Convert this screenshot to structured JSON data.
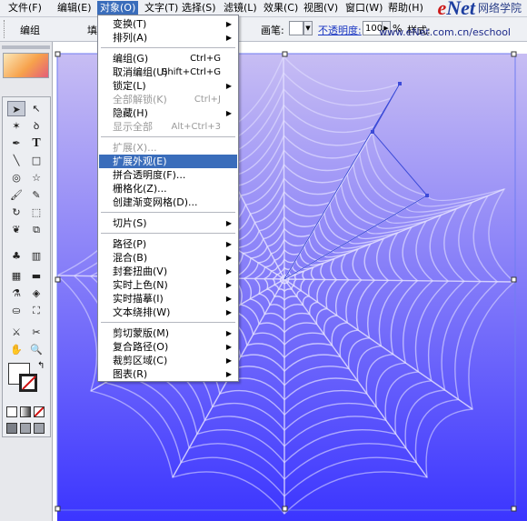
{
  "menubar": {
    "items": [
      {
        "label": "文件(F)"
      },
      {
        "label": "编辑(E)"
      },
      {
        "label": "对象(O)"
      },
      {
        "label": "文字(T)"
      },
      {
        "label": "选择(S)"
      },
      {
        "label": "滤镜(L)"
      },
      {
        "label": "效果(C)"
      },
      {
        "label": "视图(V)"
      },
      {
        "label": "窗口(W)"
      },
      {
        "label": "帮助(H)"
      }
    ]
  },
  "brand": {
    "logo": "eNet",
    "logo_e": "e",
    "logo_rest": "Net",
    "logo_suffix": ".com.cn",
    "chinese": "网络学院",
    "url": "www.eNet.com.cn/eschool"
  },
  "control_bar": {
    "group_label": "编组",
    "fill_label": "填",
    "brush_label": "画笔:",
    "opacity_label": "不透明度:",
    "opacity_value": "100",
    "percent": "%",
    "style_label": "样式:"
  },
  "object_menu": {
    "items": [
      {
        "label": "变换(T)",
        "shortcut": "",
        "submenu": true,
        "disabled": false
      },
      {
        "label": "排列(A)",
        "shortcut": "",
        "submenu": true,
        "disabled": false
      },
      {
        "label": "编组(G)",
        "shortcut": "Ctrl+G",
        "submenu": false,
        "disabled": false
      },
      {
        "label": "取消编组(U)",
        "shortcut": "Shift+Ctrl+G",
        "submenu": false,
        "disabled": false
      },
      {
        "label": "锁定(L)",
        "shortcut": "",
        "submenu": true,
        "disabled": false
      },
      {
        "label": "全部解锁(K)",
        "shortcut": "Ctrl+J",
        "submenu": false,
        "disabled": true
      },
      {
        "label": "隐藏(H)",
        "shortcut": "",
        "submenu": true,
        "disabled": false
      },
      {
        "label": "显示全部",
        "shortcut": "Alt+Ctrl+3",
        "submenu": false,
        "disabled": true
      },
      {
        "label": "扩展(X)...",
        "shortcut": "",
        "submenu": false,
        "disabled": true
      },
      {
        "label": "扩展外观(E)",
        "shortcut": "",
        "submenu": false,
        "disabled": false,
        "highlighted": true
      },
      {
        "label": "拼合透明度(F)...",
        "shortcut": "",
        "submenu": false,
        "disabled": false
      },
      {
        "label": "栅格化(Z)...",
        "shortcut": "",
        "submenu": false,
        "disabled": false
      },
      {
        "label": "创建渐变网格(D)...",
        "shortcut": "",
        "submenu": false,
        "disabled": false
      },
      {
        "label": "切片(S)",
        "shortcut": "",
        "submenu": true,
        "disabled": false
      },
      {
        "label": "路径(P)",
        "shortcut": "",
        "submenu": true,
        "disabled": false
      },
      {
        "label": "混合(B)",
        "shortcut": "",
        "submenu": true,
        "disabled": false
      },
      {
        "label": "封套扭曲(V)",
        "shortcut": "",
        "submenu": true,
        "disabled": false
      },
      {
        "label": "实时上色(N)",
        "shortcut": "",
        "submenu": true,
        "disabled": false
      },
      {
        "label": "实时描摹(I)",
        "shortcut": "",
        "submenu": true,
        "disabled": false
      },
      {
        "label": "文本绕排(W)",
        "shortcut": "",
        "submenu": true,
        "disabled": false
      },
      {
        "label": "剪切蒙版(M)",
        "shortcut": "",
        "submenu": true,
        "disabled": false
      },
      {
        "label": "复合路径(O)",
        "shortcut": "",
        "submenu": true,
        "disabled": false
      },
      {
        "label": "裁剪区域(C)",
        "shortcut": "",
        "submenu": true,
        "disabled": false
      },
      {
        "label": "图表(R)",
        "shortcut": "",
        "submenu": true,
        "disabled": false
      }
    ]
  },
  "colors": {
    "canvas_top": "#c7bdf3",
    "canvas_bottom": "#3b35ff",
    "highlight": "#3a6dbb",
    "web_line": "#e4e1ff",
    "selection": "#3d4bd8"
  }
}
